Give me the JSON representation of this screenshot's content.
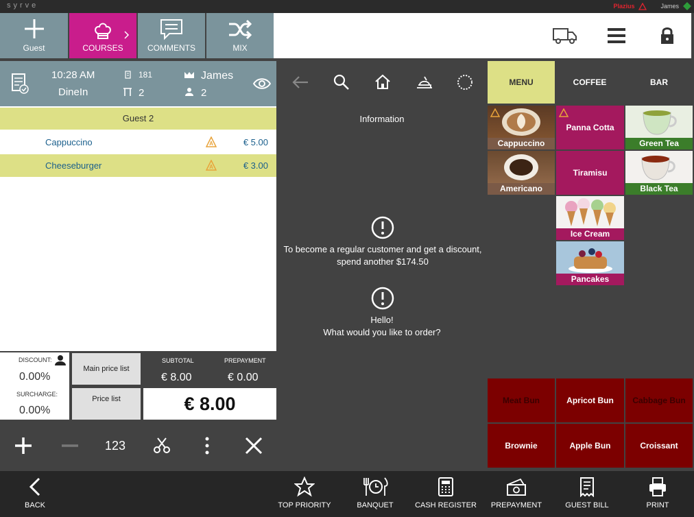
{
  "app": {
    "brand": "syrve",
    "status_label": "Plazius",
    "user": "James"
  },
  "toolbar": {
    "guest": "Guest",
    "courses": "COURSES",
    "comments": "COMMENTS",
    "mix": "MIX"
  },
  "order_info": {
    "time": "10:28 AM",
    "type": "DineIn",
    "order_number": "181",
    "table": "2",
    "waiter": "James",
    "guests": "2"
  },
  "order": {
    "guest_header": "Guest 2",
    "items": [
      {
        "name": "Cappuccino",
        "price": "€ 5.00"
      },
      {
        "name": "Cheeseburger",
        "price": "€ 3.00"
      }
    ]
  },
  "totals": {
    "discount_label": "DISCOUNT:",
    "discount": "0.00%",
    "surcharge_label": "SURCHARGE:",
    "surcharge": "0.00%",
    "main_price_list": "Main price list",
    "price_list": "Price list",
    "subtotal_label": "SUBTOTAL",
    "subtotal": "€ 8.00",
    "prepayment_label": "PREPAYMENT",
    "prepayment": "€ 0.00",
    "total": "€ 8.00"
  },
  "controls": {
    "numpad": "123"
  },
  "info": {
    "title": "Information",
    "msg1": "To become a regular customer and get a discount,",
    "msg1b": "spend another $174.50",
    "msg2": "Hello!",
    "msg2b": "What would you like to order?"
  },
  "menu_tabs": {
    "menu": "MENU",
    "coffee": "COFFEE",
    "bar": "BAR"
  },
  "products": {
    "cappuccino": "Cappuccino",
    "panna": "Panna Cotta",
    "green": "Green Tea",
    "americano": "Americano",
    "tiramisu": "Tiramisu",
    "black": "Black Tea",
    "icecream": "Ice Cream",
    "pancakes": "Pancakes"
  },
  "quick": {
    "meat": "Meat Bun",
    "apricot": "Apricot Bun",
    "cabbage": "Cabbage Bun",
    "brownie": "Brownie",
    "apple": "Apple Bun",
    "croissant": "Croissant"
  },
  "bottom": {
    "back": "BACK",
    "top_priority": "TOP PRIORITY",
    "banquet": "BANQUET",
    "cash_register": "CASH REGISTER",
    "prepayment": "PREPAYMENT",
    "guest_bill": "GUEST BILL",
    "print": "PRINT"
  },
  "colors": {
    "panel": "#7b949c",
    "accent_pink": "#c91d8c",
    "tile_pink": "#a4195e",
    "tile_red": "#7c0000",
    "highlight": "#dde086"
  }
}
